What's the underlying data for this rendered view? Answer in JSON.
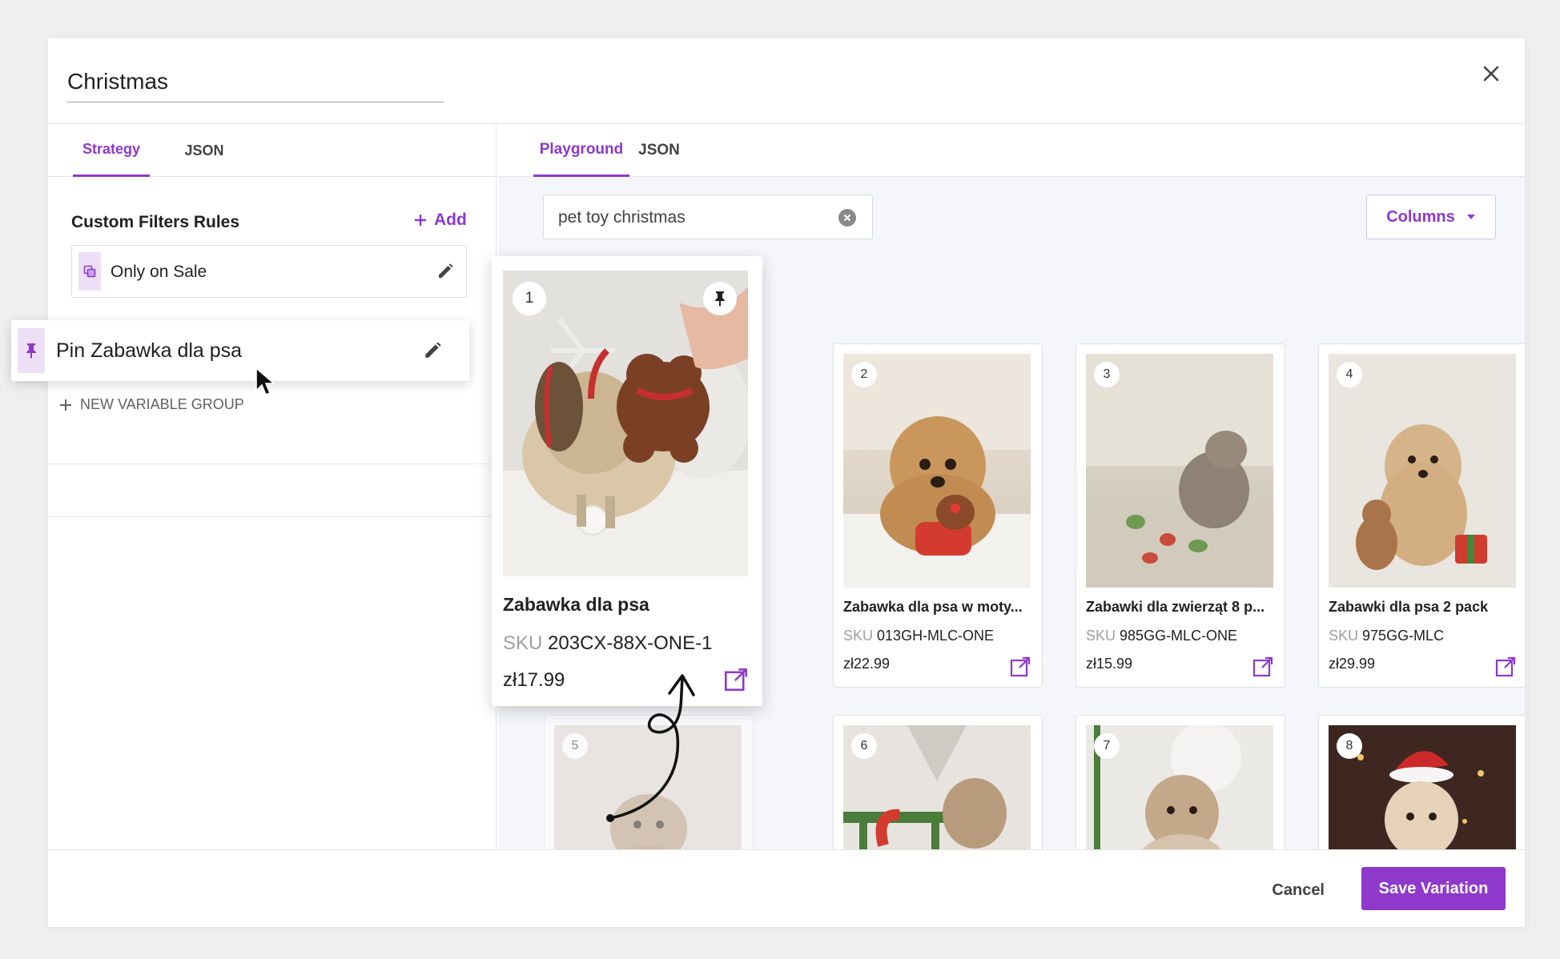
{
  "dialog": {
    "title": "Christmas"
  },
  "left_tabs": [
    {
      "label": "Strategy",
      "active": true
    },
    {
      "label": "JSON",
      "active": false
    }
  ],
  "filters": {
    "section_title": "Custom Filters Rules",
    "add_label": "Add",
    "rules": [
      {
        "label": "Only on Sale",
        "icon": "sale-filter-icon"
      }
    ],
    "new_group_label": "NEW VARIABLE GROUP"
  },
  "dragged_rule": {
    "label": "Pin Zabawka dla psa",
    "icon": "pin-icon"
  },
  "right_tabs": [
    {
      "label": "Playground",
      "active": true
    },
    {
      "label": "JSON",
      "active": false
    }
  ],
  "search": {
    "value": "pet toy christmas"
  },
  "columns_button": {
    "label": "Columns"
  },
  "featured_product": {
    "rank": "1",
    "name": "Zabawka dla psa",
    "sku_label": "SKU",
    "sku": "203CX-88X-ONE-1",
    "price": "zł17.99"
  },
  "products": [
    {
      "rank": "2",
      "name": "Zabawka dla psa w moty...",
      "sku_label": "SKU",
      "sku": "013GH-MLC-ONE",
      "price": "zł22.99"
    },
    {
      "rank": "3",
      "name": "Zabawki dla zwierząt 8 p...",
      "sku_label": "SKU",
      "sku": "985GG-MLC-ONE",
      "price": "zł15.99"
    },
    {
      "rank": "4",
      "name": "Zabawki dla psa 2 pack",
      "sku_label": "SKU",
      "sku": "975GG-MLC",
      "price": "zł29.99"
    },
    {
      "rank": "5"
    },
    {
      "rank": "6"
    },
    {
      "rank": "7"
    },
    {
      "rank": "8"
    }
  ],
  "footer": {
    "cancel_label": "Cancel",
    "save_label": "Save Variation"
  },
  "colors": {
    "accent": "#8e38cc",
    "accent_light": "#ede0f6",
    "panel_bg": "#f5f6fa"
  }
}
